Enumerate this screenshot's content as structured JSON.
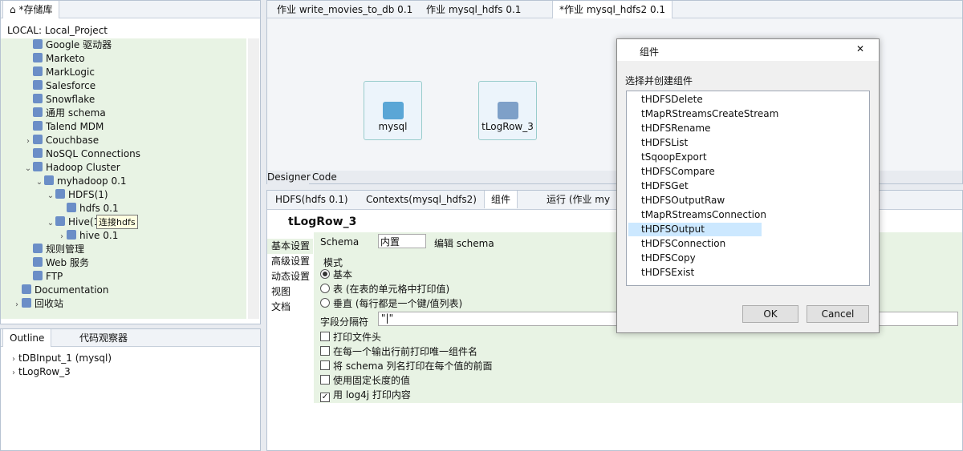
{
  "left_panel": {
    "tab": "*存储库",
    "project": "LOCAL: Local_Project",
    "items": [
      {
        "label": "Google 驱动器",
        "icon": "google-drive-icon",
        "indent": 2
      },
      {
        "label": "Marketo",
        "icon": "marketo-icon",
        "indent": 2
      },
      {
        "label": "MarkLogic",
        "icon": "marklogic-icon",
        "indent": 2
      },
      {
        "label": "Salesforce",
        "icon": "salesforce-icon",
        "indent": 2
      },
      {
        "label": "Snowflake",
        "icon": "snowflake-icon",
        "indent": 2
      },
      {
        "label": "通用 schema",
        "icon": "schema-icon",
        "indent": 2
      },
      {
        "label": "Talend MDM",
        "icon": "mdm-icon",
        "indent": 2
      },
      {
        "label": "Couchbase",
        "icon": "couchbase-icon",
        "indent": 2,
        "toggle": "›"
      },
      {
        "label": "NoSQL Connections",
        "icon": "nosql-icon",
        "indent": 2
      },
      {
        "label": "Hadoop Cluster",
        "icon": "hadoop-icon",
        "indent": 2,
        "toggle": "⌄"
      },
      {
        "label": "myhadoop 0.1",
        "icon": "hadoop-item-icon",
        "indent": 3,
        "toggle": "⌄"
      },
      {
        "label": "HDFS(1)",
        "icon": "folder-icon",
        "indent": 4,
        "toggle": "⌄"
      },
      {
        "label": "hdfs 0.1",
        "icon": "hdfs-icon",
        "indent": 5
      },
      {
        "label": "Hive(1)",
        "icon": "folder-icon",
        "indent": 4,
        "toggle": "⌄"
      },
      {
        "label": "hive 0.1",
        "icon": "hive-icon",
        "indent": 5,
        "toggle": "›"
      },
      {
        "label": "规则管理",
        "icon": "rules-icon",
        "indent": 2
      },
      {
        "label": "Web 服务",
        "icon": "web-service-icon",
        "indent": 2
      },
      {
        "label": "FTP",
        "icon": "ftp-icon",
        "indent": 2
      },
      {
        "label": "Documentation",
        "icon": "doc-icon",
        "indent": 1
      },
      {
        "label": "回收站",
        "icon": "trash-icon",
        "indent": 1,
        "toggle": "›"
      }
    ],
    "tooltip": "连接hdfs"
  },
  "outline_panel": {
    "tabs": [
      "Outline",
      "代码观察器"
    ],
    "items": [
      "tDBInput_1 (mysql)",
      "tLogRow_3"
    ]
  },
  "editor": {
    "tabs": [
      "作业 write_movies_to_db 0.1",
      "作业 mysql_hdfs 0.1",
      "*作业 mysql_hdfs2 0.1"
    ],
    "nodes": [
      "mysql",
      "tLogRow_3"
    ],
    "bottom_tabs": [
      "Designer",
      "Code"
    ]
  },
  "properties": {
    "tabs": [
      "HDFS(hdfs 0.1)",
      "Contexts(mysql_hdfs2)",
      "组件",
      "运行 (作业 my"
    ],
    "title": "tLogRow_3",
    "side_tabs": [
      "基本设置",
      "高级设置",
      "动态设置",
      "视图",
      "文档"
    ],
    "schema_label": "Schema",
    "schema_value": "内置",
    "edit_schema": "编辑 schema",
    "mode_label": "模式",
    "radios": [
      "基本",
      "表 (在表的单元格中打印值)",
      "垂直 (每行都是一个键/值列表)"
    ],
    "separator_label": "字段分隔符",
    "separator_value": "\"|\"",
    "checkboxes": [
      {
        "label": "打印文件头",
        "checked": false
      },
      {
        "label": "在每一个输出行前打印唯一组件名",
        "checked": false
      },
      {
        "label": "将 schema 列名打印在每个值的前面",
        "checked": false
      },
      {
        "label": "使用固定长度的值",
        "checked": false
      },
      {
        "label": "用 log4j 打印内容",
        "checked": true
      }
    ]
  },
  "dialog": {
    "title": "组件",
    "prompt": "选择并创建组件",
    "items": [
      "tHDFSDelete",
      "tMapRStreamsCreateStream",
      "tHDFSRename",
      "tHDFSList",
      "tSqoopExport",
      "tHDFSCompare",
      "tHDFSGet",
      "tHDFSOutputRaw",
      "tMapRStreamsConnection",
      "tHDFSOutput",
      "tHDFSConnection",
      "tHDFSCopy",
      "tHDFSExist"
    ],
    "selected": "tHDFSOutput",
    "ok": "OK",
    "cancel": "Cancel"
  }
}
